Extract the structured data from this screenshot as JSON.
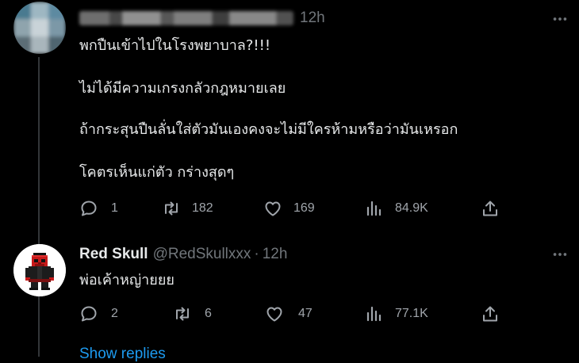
{
  "tweet1": {
    "time": "12h",
    "lines": [
      "พกปืนเข้าไปในโรงพยาบาล?!!!",
      "ไม่ได้มีความเกรงกลัวกฎหมายเลย",
      "ถ้ากระสุนปืนลั่นใส่ตัวมันเองคงจะไม่มีใครห้ามหรือว่ามันเหรอก",
      "โคตรเห็นแก่ตัว กร่างสุดๆ"
    ],
    "replies": "1",
    "reposts": "182",
    "likes": "169",
    "views": "84.9K"
  },
  "tweet2": {
    "display_name": "Red Skull",
    "handle": "@RedSkullxxx",
    "separator": "·",
    "time": "12h",
    "text": "พ่อเค้าหญ่ายยย",
    "replies": "2",
    "reposts": "6",
    "likes": "47",
    "views": "77.1K"
  },
  "show_replies": "Show replies",
  "icons": {
    "reply": "reply-icon",
    "repost": "repost-icon",
    "like": "heart-icon",
    "views": "views-icon",
    "share": "share-icon",
    "more": "more-icon"
  },
  "colors": {
    "background": "#000000",
    "text": "#e7e9ea",
    "secondary": "#71767b",
    "link": "#1d9bf0"
  }
}
